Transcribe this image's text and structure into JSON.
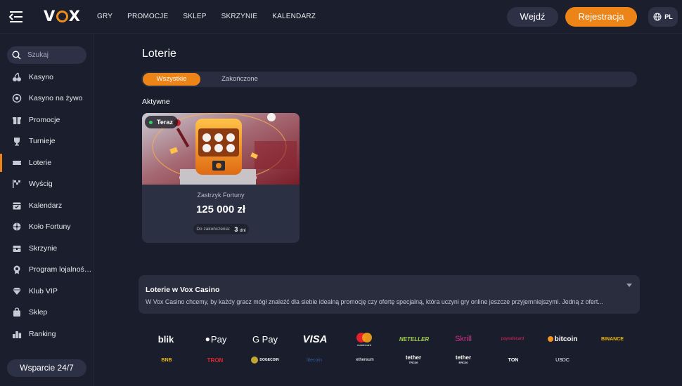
{
  "header": {
    "logo": "VOX",
    "nav": [
      "GRY",
      "PROMOCJE",
      "SKLEP",
      "SKRZYNIE",
      "KALENDARZ"
    ],
    "login_label": "Wejdź",
    "register_label": "Rejestracja",
    "lang": "PL"
  },
  "sidebar": {
    "search_placeholder": "Szukaj",
    "items": [
      {
        "label": "Kasyno",
        "icon": "cherries-icon"
      },
      {
        "label": "Kasyno na żywo",
        "icon": "live-chip-icon"
      },
      {
        "label": "Promocje",
        "icon": "gift-icon"
      },
      {
        "label": "Turnieje",
        "icon": "trophy-icon"
      },
      {
        "label": "Loterie",
        "icon": "ticket-icon",
        "active": true
      },
      {
        "label": "Wyścig",
        "icon": "race-flag-icon"
      },
      {
        "label": "Kalendarz",
        "icon": "calendar-icon"
      },
      {
        "label": "Koło Fortuny",
        "icon": "wheel-icon"
      },
      {
        "label": "Skrzynie",
        "icon": "chest-icon"
      },
      {
        "label": "Program lojalności...",
        "icon": "medal-icon"
      },
      {
        "label": "Klub VIP",
        "icon": "diamond-icon"
      },
      {
        "label": "Sklep",
        "icon": "shopping-bag-icon"
      },
      {
        "label": "Ranking",
        "icon": "ranking-icon"
      }
    ],
    "support_label": "Wsparcie 24/7"
  },
  "main": {
    "title": "Loterie",
    "tabs": [
      "Wszystkie",
      "Zakończone"
    ],
    "section_label": "Aktywne",
    "card": {
      "badge": "Teraz",
      "name": "Zastrzyk Fortuny",
      "amount": "125 000 zł",
      "deadline_label": "Do zakończenia:",
      "deadline_value": "3",
      "deadline_unit": "dni"
    },
    "info": {
      "title": "Loterie w Vox Casino",
      "text": "W Vox Casino chcemy, by każdy gracz mógł znaleźć dla siebie idealną promocję czy ofertę specjalną, która uczyni gry online jeszcze przyjemniejszymi. Jedną z ofert..."
    }
  },
  "payments": {
    "row1": [
      "blik",
      "Pay",
      "G Pay",
      "VISA",
      "mastercard",
      "NETELLER",
      "Skrill",
      "paysafecard",
      "bitcoin",
      "BINANCE"
    ],
    "row2": [
      "BNB",
      "TRON",
      "DOGECOIN",
      "litecoin",
      "ethereum",
      "tether",
      "tether",
      "TON",
      "USDC"
    ],
    "tether_sub": [
      "TRC20",
      "ERC20"
    ]
  },
  "colors": {
    "accent": "#ec8417",
    "background": "#1a1d2b",
    "panel": "#2c3043"
  }
}
